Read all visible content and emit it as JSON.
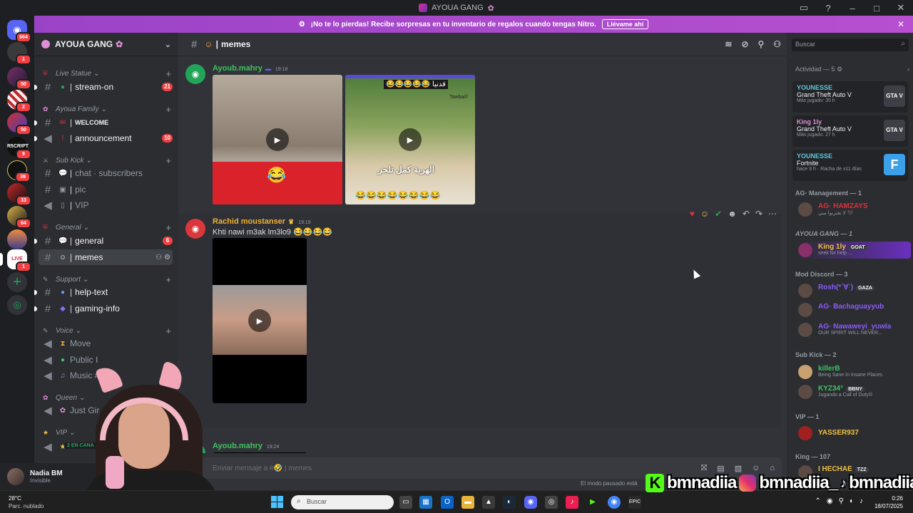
{
  "window": {
    "title": "AYOUA GANG"
  },
  "banner": {
    "text": "¡No te lo pierdas! Recibe sorpresas en tu inventario de regalos cuando tengas Nitro.",
    "button": "Llévame ahí",
    "close": "✕"
  },
  "servers": [
    {
      "badge": "664"
    },
    {
      "badge": "1"
    },
    {
      "badge": "50"
    },
    {
      "badge": "2"
    },
    {
      "badge": "50"
    },
    {
      "badge": "9"
    },
    {
      "badge": "39"
    },
    {
      "badge": "33"
    },
    {
      "badge": "64"
    },
    {
      "badge": ""
    },
    {
      "badge": "1"
    }
  ],
  "server": {
    "name": "AYOUA GANG"
  },
  "categories": {
    "live": "Live Statue",
    "family": "Ayoua Family",
    "subkick": "Sub Kick",
    "general": "General",
    "support": "Support",
    "voice": "Voice",
    "queen": "Queen",
    "vip": "VIP"
  },
  "channels": {
    "stream_on": {
      "label": "stream-on",
      "count": "21"
    },
    "welcome": {
      "label": "WELCOME"
    },
    "announcement": {
      "label": "announcement",
      "count": "10"
    },
    "chat_subscribers": {
      "label": "chat · subscribers"
    },
    "pic": {
      "label": "pic"
    },
    "vip": {
      "label": "VIP"
    },
    "general": {
      "label": "general",
      "count": "6"
    },
    "memes": {
      "label": "memes"
    },
    "help_text": {
      "label": "help-text"
    },
    "gaming_info": {
      "label": "gaming-info"
    },
    "move": {
      "label": "Move"
    },
    "public": {
      "label": "Public I"
    },
    "music": {
      "label": "Music #1"
    },
    "just_girl": {
      "label": "Just Gir"
    },
    "vip_voice": {
      "label": "2 EN CANA"
    }
  },
  "user": {
    "name": "Nadia BM",
    "status": "Invisible"
  },
  "chat": {
    "channel": "memes",
    "messages": [
      {
        "author": "Ayoub.mahry",
        "time": "19:18"
      },
      {
        "author": "Rachid moustanser",
        "time": "19:19",
        "text": "Khti nawi m3ak lm3lo9 😂😂😂😂"
      },
      {
        "author": "Ayoub.mahry",
        "time": "19:24"
      }
    ],
    "media_caption_1": "الهربة كمل تلحر",
    "media_caption_2": "Tawba///",
    "composer_placeholder": "Enviar mensaje a #🤣 | memes",
    "paused": "El modo pausado está"
  },
  "members": {
    "search_placeholder": "Buscar",
    "activity_title": "Actividad — 5",
    "activities": [
      {
        "name": "YOUNESSE",
        "game": "Grand Theft Auto V",
        "detail": "Más jugado: 35 h",
        "art": "GTA V"
      },
      {
        "name": "King 1ly",
        "game": "Grand Theft Auto V",
        "detail": "Más jugado: 27 h",
        "art": "GTA V"
      },
      {
        "name": "YOUNESSE",
        "game": "Fortnite",
        "detail": "hace 9 h · Racha de x11 días",
        "art": "F"
      }
    ],
    "groups": [
      {
        "title": "AG· Management — 1",
        "members": [
          {
            "name": "AG· HAMZAYS",
            "status": "لا تقتربوا مني 🖤",
            "color": "#e0303a"
          }
        ]
      },
      {
        "title": "AYOUA GANG — 1",
        "members": [
          {
            "name": "King 1ly",
            "tag": "GOAT",
            "status": "seek for help ...",
            "color": "#f0c040"
          }
        ]
      },
      {
        "title": "Mod Discord — 3",
        "members": [
          {
            "name": "Rosh(*´∀`)",
            "tag": "GAZA",
            "status": "",
            "color": "#8a5cf5"
          },
          {
            "name": "AG· Bachaguayyub",
            "status": "",
            "color": "#8a5cf5"
          },
          {
            "name": "AG· Nawaweyi_yuwla",
            "status": "OUR SPIRIT WILL NEVER...",
            "color": "#8a5cf5"
          }
        ]
      },
      {
        "title": "Sub Kick — 2",
        "members": [
          {
            "name": "killerB",
            "status": "Being Sane In Insane Places",
            "color": "#3ec45f"
          },
          {
            "name": "KYZ34°",
            "tag": "BBNY",
            "status": "Jugando a Call of Duty®",
            "color": "#3ec45f"
          }
        ]
      },
      {
        "title": "VIP — 1",
        "members": [
          {
            "name": "YASSER937",
            "status": "",
            "color": "#f0c040"
          }
        ]
      },
      {
        "title": "King — 107",
        "members": [
          {
            "name": "I HECHAE",
            "tag": "TZZ",
            "status": "",
            "color": "#f0c040"
          }
        ]
      }
    ]
  },
  "overlay": {
    "kick": "bmnadiia",
    "instagram": "bmnadiia_",
    "tiktok": "bmnadiia"
  },
  "taskbar": {
    "weather_temp": "28°C",
    "weather_desc": "Parc. nublado",
    "search": "Buscar",
    "time": "0:26",
    "date": "18/07/2025"
  }
}
